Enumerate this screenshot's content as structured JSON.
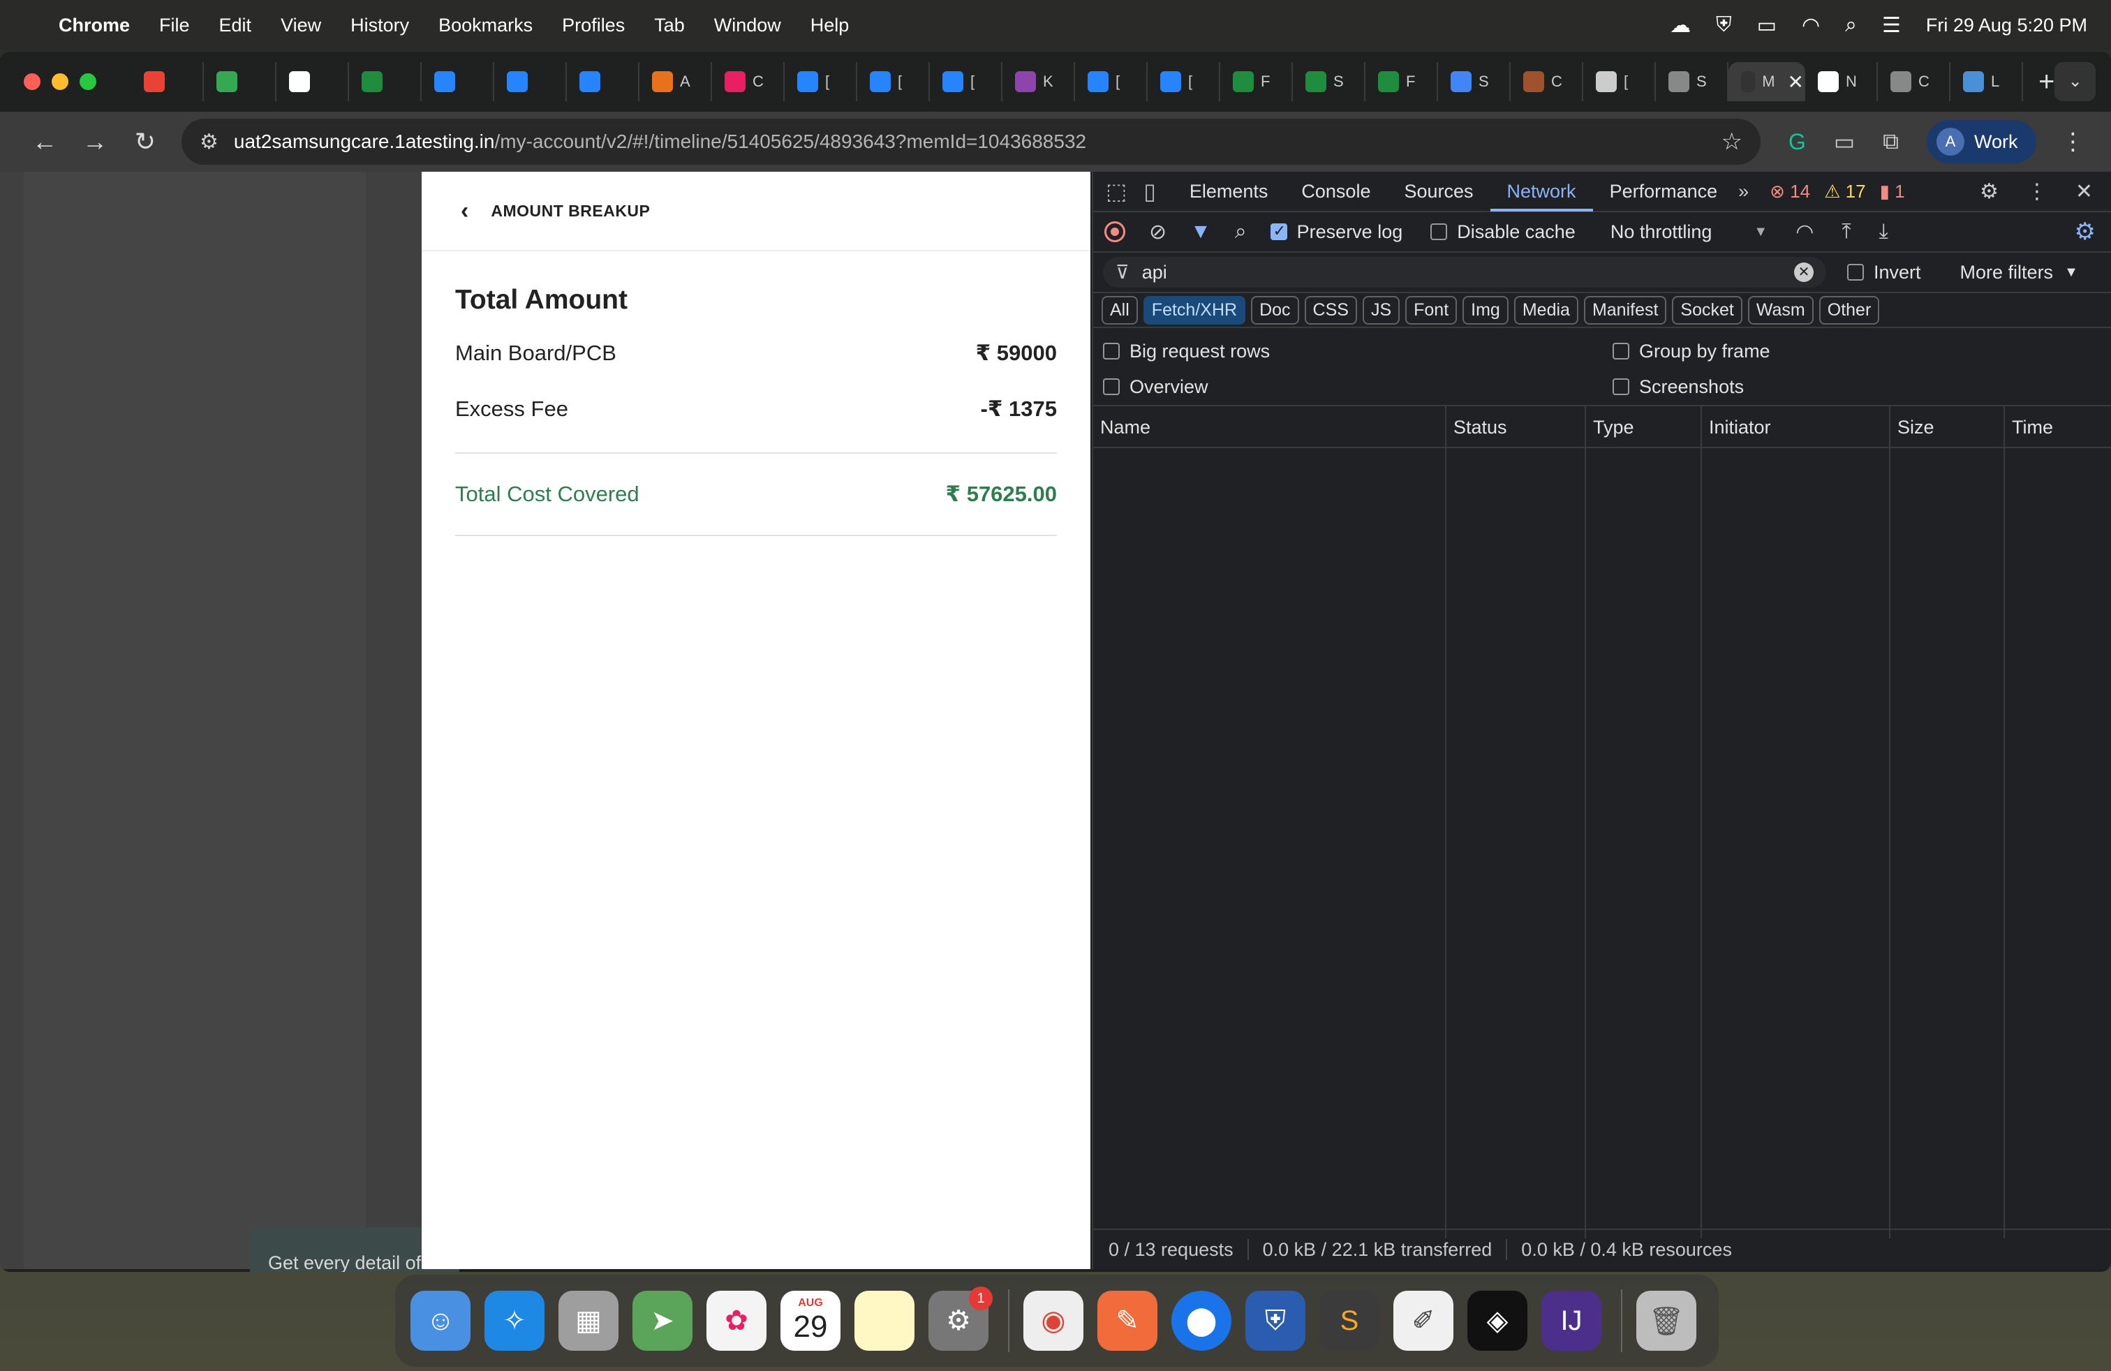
{
  "menubar": {
    "app": "Chrome",
    "items": [
      "File",
      "Edit",
      "View",
      "History",
      "Bookmarks",
      "Profiles",
      "Tab",
      "Window",
      "Help"
    ],
    "datetime": "Fri 29 Aug  5:20 PM"
  },
  "tabs": [
    {
      "letter": "",
      "color": "#ea4335"
    },
    {
      "letter": "",
      "color": "#34a853"
    },
    {
      "letter": "",
      "color": "#ffffff"
    },
    {
      "letter": "",
      "color": "#1e8e3e"
    },
    {
      "letter": "",
      "color": "#2684ff"
    },
    {
      "letter": "",
      "color": "#2684ff"
    },
    {
      "letter": "",
      "color": "#2684ff"
    },
    {
      "letter": "A",
      "color": "#e8711c"
    },
    {
      "letter": "C",
      "color": "#e91e63"
    },
    {
      "letter": "[",
      "color": "#2684ff"
    },
    {
      "letter": "[",
      "color": "#2684ff"
    },
    {
      "letter": "[",
      "color": "#2684ff"
    },
    {
      "letter": "K",
      "color": "#8e44ad"
    },
    {
      "letter": "[",
      "color": "#2684ff"
    },
    {
      "letter": "[",
      "color": "#2684ff"
    },
    {
      "letter": "F",
      "color": "#1e8e3e"
    },
    {
      "letter": "S",
      "color": "#1e8e3e"
    },
    {
      "letter": "F",
      "color": "#1e8e3e"
    },
    {
      "letter": "S",
      "color": "#4285f4"
    },
    {
      "letter": "C",
      "color": "#a0522d"
    },
    {
      "letter": "[",
      "color": "#cccccc"
    },
    {
      "letter": "S",
      "color": "#888888"
    },
    {
      "letter": "M",
      "color": "#333333",
      "active": true
    },
    {
      "letter": "N",
      "color": "#ffffff"
    },
    {
      "letter": "C",
      "color": "#888888"
    },
    {
      "letter": "L",
      "color": "#4a90d9"
    }
  ],
  "address": {
    "host": "uat2samsungcare.1atesting.in",
    "path": "/my-account/v2/#!/timeline/51405625/4893643?memId=1043688532"
  },
  "profile": {
    "initial": "A",
    "label": "Work"
  },
  "toast": {
    "text": "Get every detail of"
  },
  "modal": {
    "header": "AMOUNT BREAKUP",
    "total_title": "Total Amount",
    "rows": [
      {
        "label": "Main Board/PCB",
        "amount": "₹ 59000"
      },
      {
        "label": "Excess Fee",
        "amount": "-₹ 1375"
      }
    ],
    "covered": {
      "label": "Total Cost Covered",
      "amount": "₹ 57625.00"
    }
  },
  "devtools": {
    "tabs": [
      "Elements",
      "Console",
      "Sources",
      "Network",
      "Performance"
    ],
    "active_tab": "Network",
    "errors": "14",
    "warnings": "17",
    "issues": "1",
    "preserve_log": "Preserve log",
    "disable_cache": "Disable cache",
    "throttling": "No throttling",
    "filter_value": "api",
    "invert": "Invert",
    "more_filters": "More filters",
    "types": [
      "All",
      "Fetch/XHR",
      "Doc",
      "CSS",
      "JS",
      "Font",
      "Img",
      "Media",
      "Manifest",
      "Socket",
      "Wasm",
      "Other"
    ],
    "active_type": "Fetch/XHR",
    "options": [
      "Big request rows",
      "Group by frame",
      "Overview",
      "Screenshots"
    ],
    "columns": [
      "Name",
      "Status",
      "Type",
      "Initiator",
      "Size",
      "Time"
    ],
    "status": {
      "requests": "0 / 13 requests",
      "transferred": "0.0 kB / 22.1 kB transferred",
      "resources": "0.0 kB / 0.4 kB resources"
    }
  },
  "dock": {
    "calendar_month": "AUG",
    "calendar_day": "29",
    "settings_badge": "1"
  }
}
